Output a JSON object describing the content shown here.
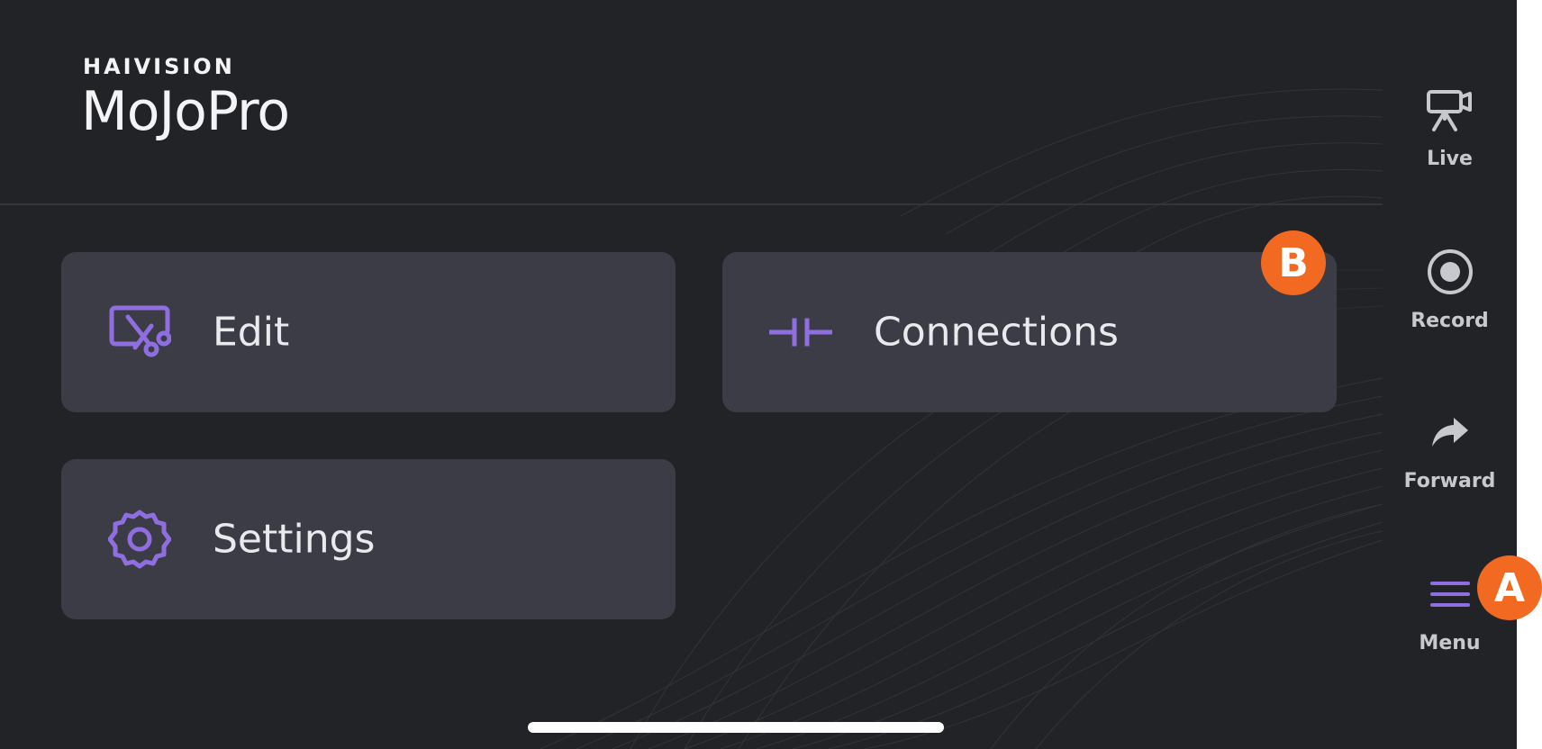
{
  "brand": {
    "company": "HAIVISION",
    "product": "MoJoPro"
  },
  "tiles": {
    "edit": {
      "label": "Edit",
      "icon": "video-edit-scissors-icon"
    },
    "connections": {
      "label": "Connections",
      "icon": "connections-plug-icon"
    },
    "settings": {
      "label": "Settings",
      "icon": "gear-icon"
    }
  },
  "side_nav": {
    "live": {
      "label": "Live",
      "icon": "camera-icon"
    },
    "record": {
      "label": "Record",
      "icon": "record-icon"
    },
    "forward": {
      "label": "Forward",
      "icon": "forward-arrow-icon"
    },
    "menu": {
      "label": "Menu",
      "icon": "hamburger-menu-icon"
    }
  },
  "callouts": {
    "a": "A",
    "b": "B"
  },
  "colors": {
    "background": "#222326",
    "tile": "#3c3c47",
    "accent_purple": "#8f6fe0",
    "callout_orange": "#f26a21",
    "text": "#e9e9ee"
  }
}
